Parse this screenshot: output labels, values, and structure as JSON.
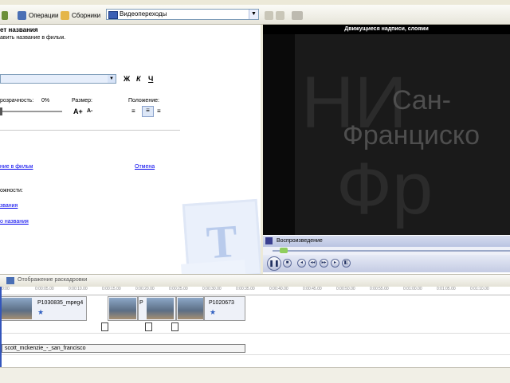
{
  "menubar": {
    "items": [
      "",
      "",
      "",
      ""
    ]
  },
  "toolbar": {
    "operations_label": "Операции",
    "collections_label": "Сборники",
    "collection_selected": "Видеопереходы"
  },
  "task_pane": {
    "heading": "ет названия",
    "subheading": "авить название в фильм.",
    "transparency_label": "розрачность:",
    "transparency_value": "0%",
    "size_label": "Размер:",
    "position_label": "Положение:",
    "format_buttons": [
      "Ж",
      "К",
      "Ч"
    ],
    "done_link": "ние в фильм",
    "cancel_link": "Отмена",
    "more_options_label": "ожности:",
    "option_link_1": "звания",
    "option_link_2": "о названия",
    "watermark": "T"
  },
  "monitor": {
    "title": "Движущиеся надписи, слоями",
    "overlay_line1": "Сан-",
    "overlay_line2": "Франциско",
    "bg_text_1": "НИ",
    "bg_text_2": "Фр",
    "status": "Воспроизведение",
    "seek_fraction": 0.03
  },
  "storyboard": {
    "header": "Отображение раскадровки",
    "ruler": [
      "0:00",
      "0:00:05.00",
      "0:00:10.00",
      "0:00:15.00",
      "0:00:20.00",
      "0:00:25.00",
      "0:00:30.00",
      "0:00:35.00",
      "0:00:40.00",
      "0:00:45.00",
      "0:00:50.00",
      "0:00:55.00",
      "0:01:00.00",
      "0:01:05.00",
      "0:01:10.00"
    ],
    "clips": [
      {
        "name": "P1030835_mpeg4"
      },
      {
        "name": ""
      },
      {
        "name": "P"
      },
      {
        "name": ""
      },
      {
        "name": "P1020673"
      }
    ],
    "audio_clip": "scott_mckenzie_-_san_francisco"
  },
  "colors": {
    "link": "#0000ee",
    "accent": "#3355bb",
    "star": "#2f5fc0"
  }
}
